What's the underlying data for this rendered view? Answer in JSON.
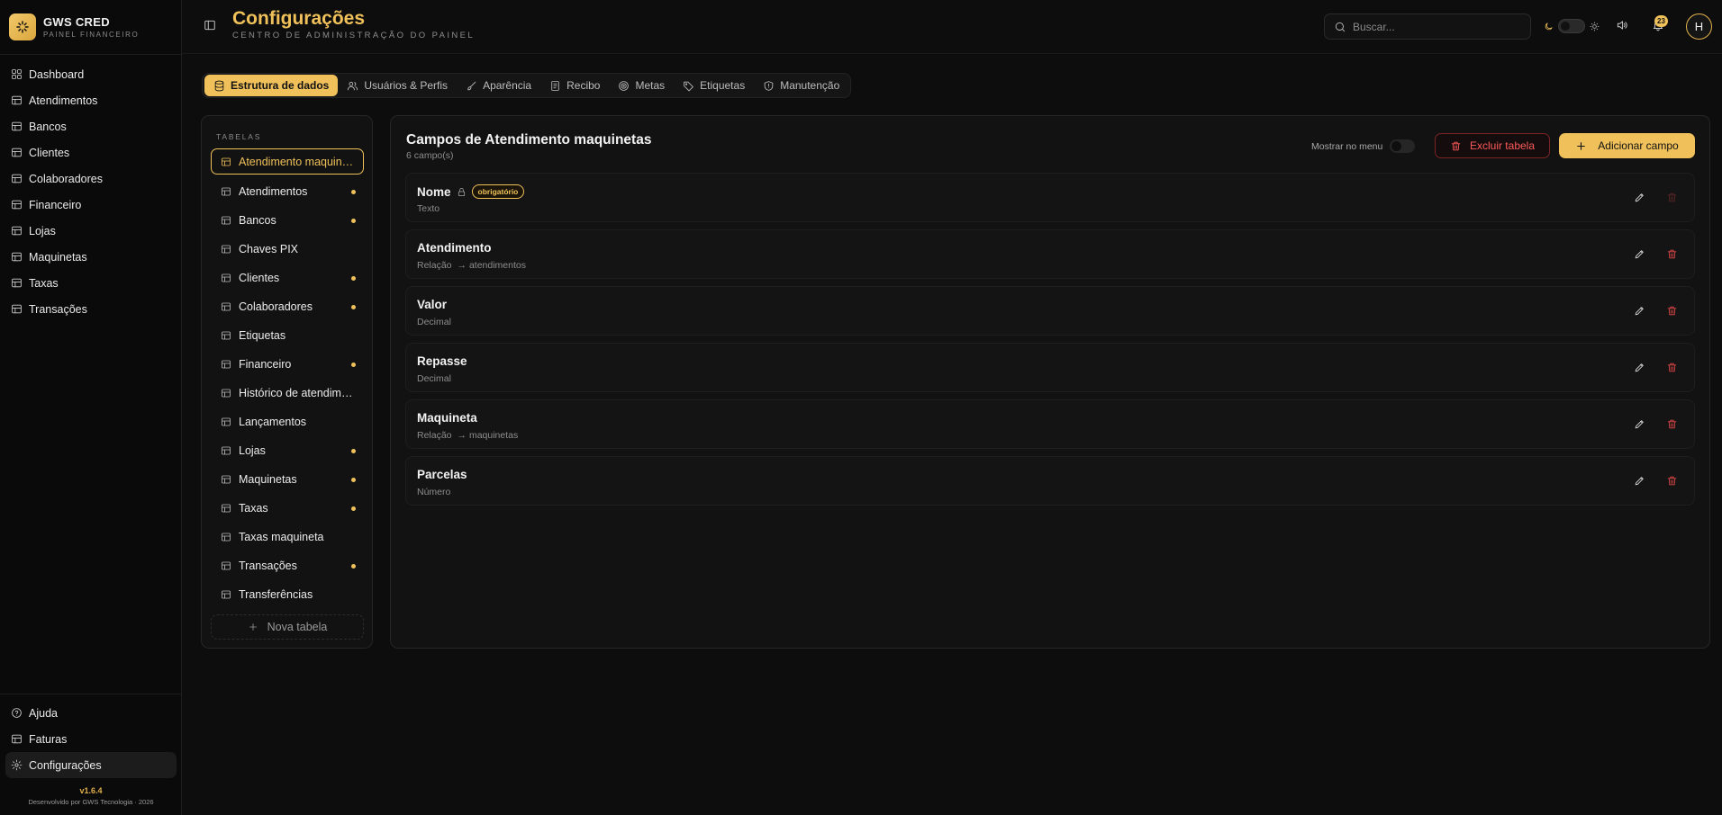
{
  "brand": {
    "title": "GWS CRED",
    "subtitle": "PAINEL FINANCEIRO"
  },
  "sidebar": {
    "items": [
      {
        "label": "Dashboard",
        "icon": "grid-icon"
      },
      {
        "label": "Atendimentos",
        "icon": "table-icon"
      },
      {
        "label": "Bancos",
        "icon": "table-icon"
      },
      {
        "label": "Clientes",
        "icon": "table-icon"
      },
      {
        "label": "Colaboradores",
        "icon": "table-icon"
      },
      {
        "label": "Financeiro",
        "icon": "table-icon"
      },
      {
        "label": "Lojas",
        "icon": "table-icon"
      },
      {
        "label": "Maquinetas",
        "icon": "table-icon"
      },
      {
        "label": "Taxas",
        "icon": "table-icon"
      },
      {
        "label": "Transações",
        "icon": "table-icon"
      }
    ],
    "bottom": [
      {
        "label": "Ajuda",
        "icon": "help-icon"
      },
      {
        "label": "Faturas",
        "icon": "invoice-icon"
      },
      {
        "label": "Configurações",
        "icon": "gear-icon",
        "active": true
      }
    ],
    "version": "v1.6.4",
    "credits": "Desenvolvido por GWS Tecnologia · 2026"
  },
  "header": {
    "title": "Configurações",
    "subtitle": "CENTRO DE ADMINISTRAÇÃO DO PAINEL",
    "search_placeholder": "Buscar...",
    "notifications": "23",
    "avatar": "H"
  },
  "tabs": [
    {
      "label": "Estrutura de dados",
      "icon": "database-icon",
      "active": true
    },
    {
      "label": "Usuários & Perfis",
      "icon": "users-icon"
    },
    {
      "label": "Aparência",
      "icon": "brush-icon"
    },
    {
      "label": "Recibo",
      "icon": "receipt-icon"
    },
    {
      "label": "Metas",
      "icon": "target-icon"
    },
    {
      "label": "Etiquetas",
      "icon": "tag-icon"
    },
    {
      "label": "Manutenção",
      "icon": "shield-icon"
    }
  ],
  "tables": {
    "heading": "TABELAS",
    "items": [
      {
        "label": "Atendimento maquinetas",
        "selected": true,
        "dot": false
      },
      {
        "label": "Atendimentos",
        "dot": true
      },
      {
        "label": "Bancos",
        "dot": true
      },
      {
        "label": "Chaves PIX",
        "dot": false
      },
      {
        "label": "Clientes",
        "dot": true
      },
      {
        "label": "Colaboradores",
        "dot": true
      },
      {
        "label": "Etiquetas",
        "dot": false
      },
      {
        "label": "Financeiro",
        "dot": true
      },
      {
        "label": "Histórico de atendimentos",
        "dot": false
      },
      {
        "label": "Lançamentos",
        "dot": false
      },
      {
        "label": "Lojas",
        "dot": true
      },
      {
        "label": "Maquinetas",
        "dot": true
      },
      {
        "label": "Taxas",
        "dot": true
      },
      {
        "label": "Taxas maquineta",
        "dot": false
      },
      {
        "label": "Transações",
        "dot": true
      },
      {
        "label": "Transferências",
        "dot": false
      }
    ],
    "new_label": "Nova tabela"
  },
  "fields": {
    "title": "Campos de Atendimento maquinetas",
    "count": "6 campo(s)",
    "show_menu_label": "Mostrar no menu",
    "delete_table_label": "Excluir tabela",
    "add_field_label": "Adicionar campo",
    "required_label": "obrigatório",
    "items": [
      {
        "name": "Nome",
        "type": "Texto",
        "relation": "",
        "locked": true,
        "required": true
      },
      {
        "name": "Atendimento",
        "type": "Relação",
        "relation": "→ atendimentos"
      },
      {
        "name": "Valor",
        "type": "Decimal",
        "relation": ""
      },
      {
        "name": "Repasse",
        "type": "Decimal",
        "relation": ""
      },
      {
        "name": "Maquineta",
        "type": "Relação",
        "relation": "→ maquinetas"
      },
      {
        "name": "Parcelas",
        "type": "Número",
        "relation": ""
      }
    ]
  },
  "colors": {
    "accent": "#f0c15a",
    "danger": "#e04848",
    "background": "#0d0d0d"
  }
}
